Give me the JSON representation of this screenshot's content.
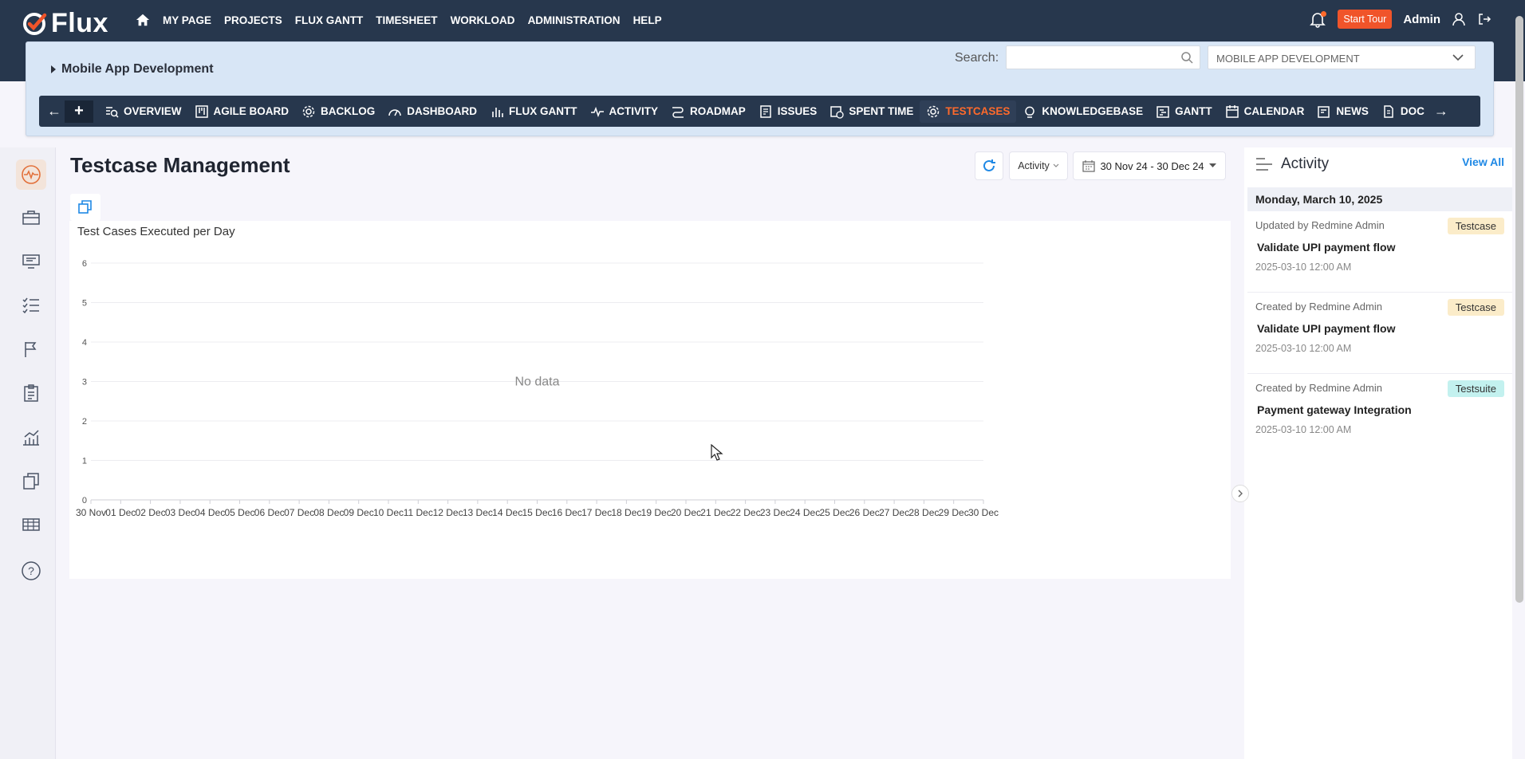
{
  "brand": {
    "name": "Flux",
    "accent": "#f0542a",
    "header_bg": "#27374d"
  },
  "topnav": {
    "items": [
      "MY PAGE",
      "PROJECTS",
      "FLUX GANTT",
      "TIMESHEET",
      "WORKLOAD",
      "ADMINISTRATION",
      "HELP"
    ],
    "start_tour": "Start Tour",
    "user": "Admin"
  },
  "project": {
    "name": "Mobile App Development",
    "search_label": "Search:",
    "search_value": "",
    "selected_project": "MOBILE APP DEVELOPMENT"
  },
  "tabs": [
    {
      "label": "OVERVIEW",
      "icon": "overview-icon"
    },
    {
      "label": "AGILE BOARD",
      "icon": "board-icon"
    },
    {
      "label": "BACKLOG",
      "icon": "gear-icon"
    },
    {
      "label": "DASHBOARD",
      "icon": "gauge-icon"
    },
    {
      "label": "FLUX GANTT",
      "icon": "bar-chart-icon"
    },
    {
      "label": "ACTIVITY",
      "icon": "pulse-icon"
    },
    {
      "label": "ROADMAP",
      "icon": "roadmap-icon"
    },
    {
      "label": "ISSUES",
      "icon": "issues-icon"
    },
    {
      "label": "SPENT TIME",
      "icon": "calendar-clock-icon"
    },
    {
      "label": "TESTCASES",
      "icon": "gear-icon",
      "active": true
    },
    {
      "label": "KNOWLEDGEBASE",
      "icon": "bulb-icon"
    },
    {
      "label": "GANTT",
      "icon": "gantt-icon"
    },
    {
      "label": "CALENDAR",
      "icon": "calendar-icon"
    },
    {
      "label": "NEWS",
      "icon": "news-icon"
    },
    {
      "label": "DOC",
      "icon": "doc-icon"
    }
  ],
  "main": {
    "title": "Testcase Management",
    "activity_filter": "Activity",
    "date_range": "30 Nov 24 - 30 Dec 24"
  },
  "chart_data": {
    "type": "line",
    "title": "Test Cases Executed per Day",
    "empty_message": "No data",
    "x": [
      "30 Nov",
      "01 Dec",
      "02 Dec",
      "03 Dec",
      "04 Dec",
      "05 Dec",
      "06 Dec",
      "07 Dec",
      "08 Dec",
      "09 Dec",
      "10 Dec",
      "11 Dec",
      "12 Dec",
      "13 Dec",
      "14 Dec",
      "15 Dec",
      "16 Dec",
      "17 Dec",
      "18 Dec",
      "19 Dec",
      "20 Dec",
      "21 Dec",
      "22 Dec",
      "23 Dec",
      "24 Dec",
      "25 Dec",
      "26 Dec",
      "27 Dec",
      "28 Dec",
      "29 Dec",
      "30 Dec"
    ],
    "yticks": [
      0,
      1,
      2,
      3,
      4,
      5,
      6
    ],
    "ylim": [
      0,
      6
    ],
    "series": [],
    "grid": true
  },
  "activity_panel": {
    "title": "Activity",
    "view_all": "View All",
    "date": "Monday, March 10, 2025",
    "entries": [
      {
        "by": "Updated by Redmine Admin",
        "badge": "Testcase",
        "title": "Validate UPI payment flow",
        "time": "2025-03-10 12:00 AM"
      },
      {
        "by": "Created by Redmine Admin",
        "badge": "Testcase",
        "title": "Validate UPI payment flow",
        "time": "2025-03-10 12:00 AM"
      },
      {
        "by": "Created by Redmine Admin",
        "badge": "Testsuite",
        "title": "Payment gateway Integration",
        "time": "2025-03-10 12:00 AM"
      }
    ]
  }
}
